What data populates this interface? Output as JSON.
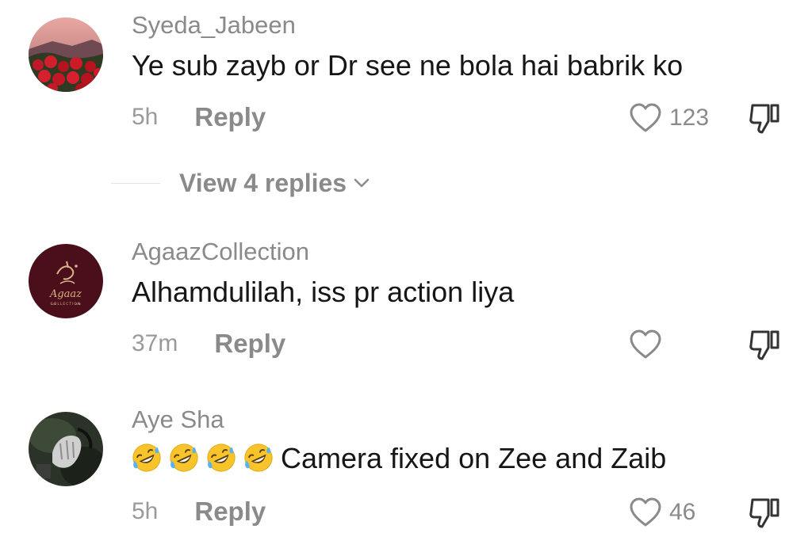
{
  "comments": [
    {
      "username": "Syeda_Jabeen",
      "text": "Ye sub zayb or Dr see ne bola hai babrik ko",
      "time": "5h",
      "reply_label": "Reply",
      "likes": "123",
      "avatar_icon": "red-roses-avatar",
      "view_replies": "View 4 replies"
    },
    {
      "username": "AgaazCollection",
      "text": "Alhamdulilah, iss pr action liya",
      "time": "37m",
      "reply_label": "Reply",
      "likes": "",
      "avatar_icon": "agaaz-logo-avatar",
      "avatar_logo_text": "Agaaz",
      "avatar_logo_sub": "COLLECTION"
    },
    {
      "username": "Aye Sha",
      "emoji": [
        "rolling-on-floor-laughing-emoji",
        "rolling-on-floor-laughing-emoji",
        "rolling-on-floor-laughing-emoji",
        "rolling-on-floor-laughing-emoji"
      ],
      "text": "Camera fixed on Zee and Zaib",
      "time": "5h",
      "reply_label": "Reply",
      "likes": "46",
      "avatar_icon": "dark-photo-avatar"
    }
  ],
  "colors": {
    "username": "#8a8a8a",
    "text": "#161616",
    "meta": "#9a9a9a",
    "background": "#ffffff"
  }
}
